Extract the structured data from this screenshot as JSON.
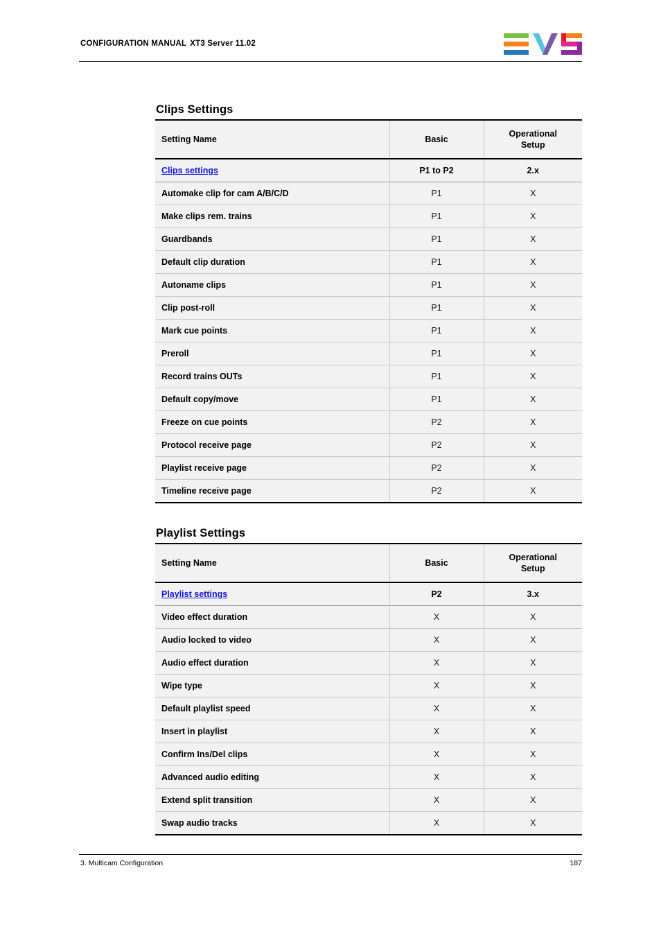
{
  "header": {
    "manual_name": "CONFIGURATION MANUAL",
    "product": "XT3 Server 11.02",
    "logo_alt": "EVS"
  },
  "sections": [
    {
      "id": "clips",
      "heading": "Clips Settings",
      "columns": [
        "Setting Name",
        "Basic",
        "Operational Setup"
      ],
      "column_header_ops_line1": "Operational",
      "column_header_ops_line2": "Setup",
      "link_row": {
        "name": "Clips settings",
        "basic": "P1 to P2",
        "operational_setup": "2.x"
      },
      "rows": [
        {
          "name": "Automake clip for cam A/B/C/D",
          "basic": "P1",
          "operational_setup": "X"
        },
        {
          "name": "Make clips rem. trains",
          "basic": "P1",
          "operational_setup": "X"
        },
        {
          "name": "Guardbands",
          "basic": "P1",
          "operational_setup": "X"
        },
        {
          "name": "Default clip duration",
          "basic": "P1",
          "operational_setup": "X"
        },
        {
          "name": "Autoname clips",
          "basic": "P1",
          "operational_setup": "X"
        },
        {
          "name": "Clip post-roll",
          "basic": "P1",
          "operational_setup": "X"
        },
        {
          "name": "Mark cue points",
          "basic": "P1",
          "operational_setup": "X"
        },
        {
          "name": "Preroll",
          "basic": "P1",
          "operational_setup": "X"
        },
        {
          "name": "Record trains OUTs",
          "basic": "P1",
          "operational_setup": "X"
        },
        {
          "name": "Default copy/move",
          "basic": "P1",
          "operational_setup": "X"
        },
        {
          "name": "Freeze on cue points",
          "basic": "P2",
          "operational_setup": "X"
        },
        {
          "name": "Protocol receive page",
          "basic": "P2",
          "operational_setup": "X"
        },
        {
          "name": "Playlist receive page",
          "basic": "P2",
          "operational_setup": "X"
        },
        {
          "name": "Timeline receive page",
          "basic": "P2",
          "operational_setup": "X"
        }
      ]
    },
    {
      "id": "playlist",
      "heading": "Playlist Settings",
      "columns": [
        "Setting Name",
        "Basic",
        "Operational Setup"
      ],
      "column_header_ops_line1": "Operational",
      "column_header_ops_line2": "Setup",
      "link_row": {
        "name": "Playlist settings",
        "basic": "P2",
        "operational_setup": "3.x"
      },
      "rows": [
        {
          "name": "Video effect duration",
          "basic": "X",
          "operational_setup": "X"
        },
        {
          "name": "Audio locked to video",
          "basic": "X",
          "operational_setup": "X"
        },
        {
          "name": "Audio effect duration",
          "basic": "X",
          "operational_setup": "X"
        },
        {
          "name": "Wipe type",
          "basic": "X",
          "operational_setup": "X"
        },
        {
          "name": "Default playlist speed",
          "basic": "X",
          "operational_setup": "X"
        },
        {
          "name": "Insert in playlist",
          "basic": "X",
          "operational_setup": "X"
        },
        {
          "name": "Confirm Ins/Del clips",
          "basic": "X",
          "operational_setup": "X"
        },
        {
          "name": "Advanced audio editing",
          "basic": "X",
          "operational_setup": "X"
        },
        {
          "name": "Extend split transition",
          "basic": "X",
          "operational_setup": "X"
        },
        {
          "name": "Swap audio tracks",
          "basic": "X",
          "operational_setup": "X"
        }
      ]
    }
  ],
  "footer": {
    "chapter": "3. Multicam Configuration",
    "page_number": "187"
  },
  "colors": {
    "link": "#1414e0",
    "table_background": "#f2f2f2",
    "rule": "#000000",
    "logo_green": "#7ac143",
    "logo_orange": "#f5831f",
    "logo_blue": "#2878c0",
    "logo_lightblue": "#5bc2e7",
    "logo_purple": "#7b5aa6",
    "logo_red": "#e8182c",
    "logo_pink": "#e6268f",
    "logo_violet": "#8b2a9b"
  }
}
